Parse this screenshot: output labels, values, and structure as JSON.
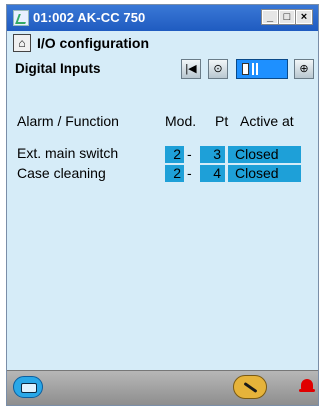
{
  "window": {
    "title": "01:002 AK-CC 750",
    "controls": {
      "minimize": "_",
      "maximize": "□",
      "close": "×"
    }
  },
  "page": {
    "title": "I/O configuration",
    "section": "Digital Inputs"
  },
  "nav": {
    "first_icon": "skip-back-icon",
    "prev_icon": "circle-icon",
    "next_icon": "plus-icon",
    "scroll_position_fraction": 0.0
  },
  "table": {
    "headers": {
      "alarm_function": "Alarm / Function",
      "mod": "Mod.",
      "pt": "Pt",
      "active_at": "Active at"
    },
    "rows": [
      {
        "label": "Ext. main switch",
        "mod": "2",
        "sep": "-",
        "pt": "3",
        "active_at": "Closed"
      },
      {
        "label": "Case cleaning",
        "mod": "2",
        "sep": "-",
        "pt": "4",
        "active_at": "Closed"
      }
    ]
  },
  "footer": {
    "left_icon": "device-icon",
    "mid_icon": "wrench-icon",
    "right_icon": "alarm-bell-icon"
  },
  "colors": {
    "background": "#d6ecf8",
    "titlebar": "#1f5bc0",
    "cell": "#1ea0d8",
    "slider": "#1e90ff",
    "alarm": "#e00000"
  }
}
